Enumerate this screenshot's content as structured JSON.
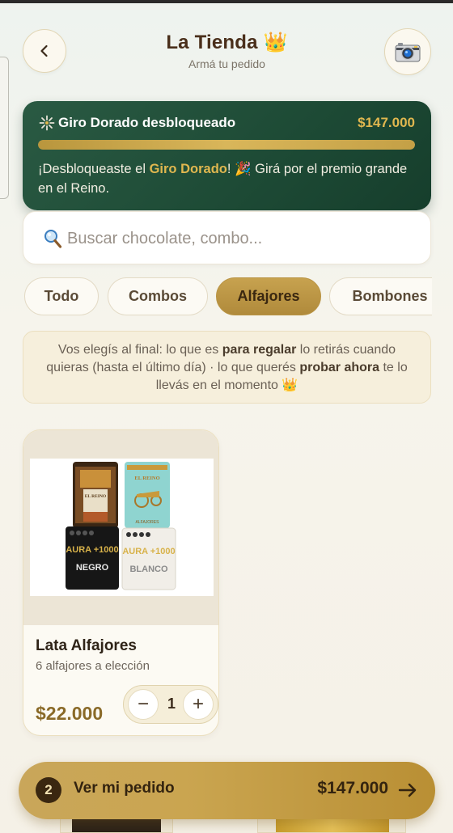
{
  "header": {
    "title": "La Tienda",
    "title_emoji": "👑",
    "subtitle": "Armá tu pedido",
    "back_icon": "chevron-left-icon",
    "camera_icon": "camera-icon"
  },
  "banner": {
    "title": "Giro Dorado desbloqueado",
    "amount": "$147.000",
    "progress_percent": 100,
    "text_before": "¡Desbloqueaste el ",
    "text_highlight": "Giro Dorado",
    "text_after": "! 🎉 Girá por el premio grande en el Reino.",
    "accent_color": "#e0b74f",
    "background_color": "#1d4a35"
  },
  "search": {
    "placeholder": "Buscar chocolate, combo...",
    "value": "",
    "icon": "search-icon"
  },
  "categories": [
    {
      "label": "Todo",
      "active": false
    },
    {
      "label": "Combos",
      "active": false
    },
    {
      "label": "Alfajores",
      "active": true
    },
    {
      "label": "Bombones",
      "active": false
    }
  ],
  "info": {
    "part1": "Vos elegís al final: lo que es ",
    "bold1": "para regalar",
    "part2": " lo retirás cuando quieras (hasta el último día) · lo que querés ",
    "bold2": "probar ahora",
    "part3": " te lo llevás en el momento 👑"
  },
  "products": [
    {
      "name": "Lata Alfajores",
      "description": "6 alfajores a elección",
      "price": "$22.000",
      "quantity": "1",
      "minus_label": "−",
      "plus_label": "+",
      "image_texts": [
        "EL REINO",
        "ALFAJORES",
        "AURA +1000",
        "NEGRO",
        "BLANCO"
      ]
    }
  ],
  "order_bar": {
    "count": "2",
    "label": "Ver mi pedido",
    "total": "$147.000",
    "icon": "arrow-right-icon"
  },
  "colors": {
    "gold": "#c9a65a",
    "dark_green": "#1d4a35",
    "brown": "#4a2f1b"
  }
}
